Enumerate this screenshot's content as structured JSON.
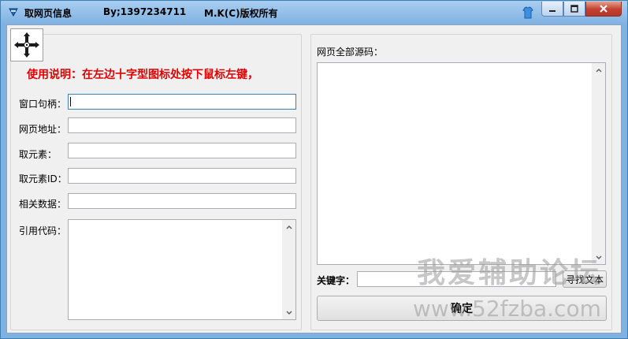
{
  "window": {
    "title": "取网页信息",
    "author": "By;1397234711",
    "copyright": "M.K(C)版权所有"
  },
  "left": {
    "instruction": "使用说明：在左边十字型图标处按下鼠标左键，",
    "fields": [
      {
        "label": "窗口句柄：",
        "value": ""
      },
      {
        "label": "网页地址：",
        "value": ""
      },
      {
        "label": "取元素：",
        "value": ""
      },
      {
        "label": "取元素ID：",
        "value": ""
      },
      {
        "label": "相关数据：",
        "value": ""
      }
    ],
    "code_label": "引用代码：",
    "code_value": ""
  },
  "right": {
    "source_label": "网页全部源码：",
    "source_value": "",
    "keyword_label": "关键字：",
    "keyword_value": "",
    "find_button": "寻找文本",
    "ok_button": "确定"
  },
  "watermark": {
    "line1": "我爱辅助论坛",
    "line2": "www.52fzba.com"
  },
  "colors": {
    "instruction": "#e00000",
    "titlebar": "#a9cdf0",
    "close": "#c2402f"
  },
  "icons": {
    "app": "app-icon",
    "crosshair": "crosshair-icon",
    "tray": "tshirt-icon"
  }
}
